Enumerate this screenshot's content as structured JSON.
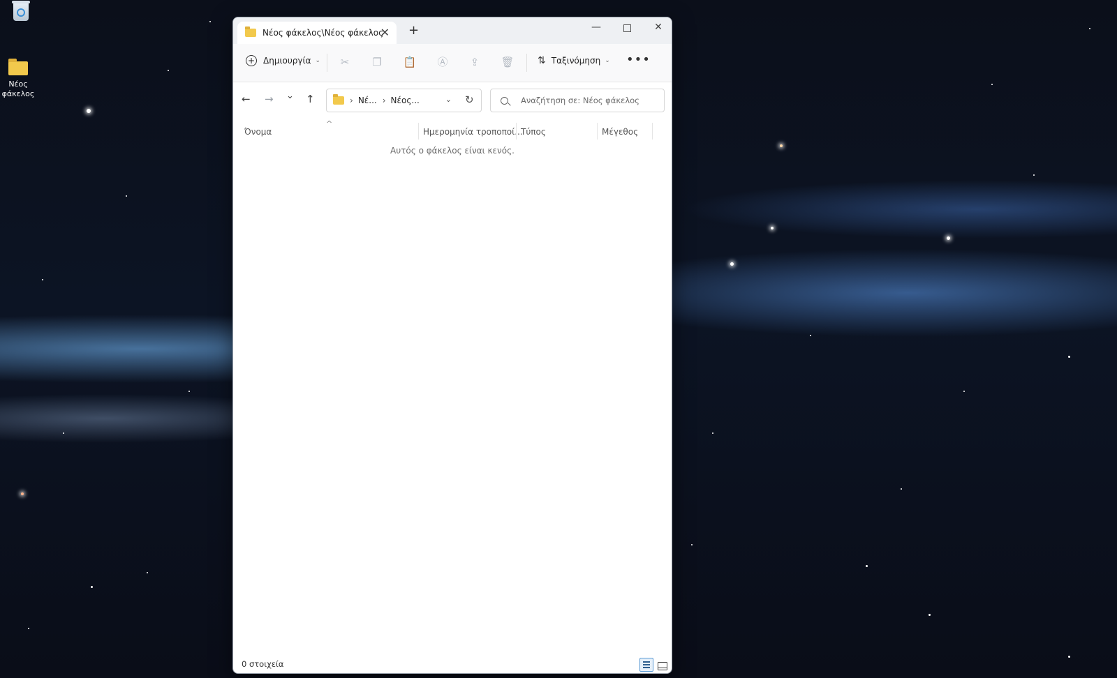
{
  "desktop": {
    "recycle_bin": {
      "icon": "recycle-bin-icon"
    },
    "folder": {
      "label": "Νέος φάκελος",
      "icon": "folder-icon"
    }
  },
  "window": {
    "tab": {
      "title": "Νέος φάκελος\\Νέος φάκελος",
      "icon": "folder-icon",
      "close": "✕"
    },
    "new_tab": "+",
    "controls": {
      "minimize": "—",
      "maximize": "",
      "close": "✕"
    },
    "toolbar": {
      "new_label": "Δημιουργία",
      "sort_label": "Ταξινόμηση",
      "more": "•••",
      "icons": [
        "cut-icon",
        "copy-icon",
        "paste-icon",
        "rename-icon",
        "share-icon",
        "delete-icon"
      ]
    },
    "nav": {
      "back": "←",
      "forward": "→",
      "recent": "⌄",
      "up": "↑",
      "breadcrumb": [
        "Νέ...",
        "Νέος..."
      ],
      "crumb_sep": "›",
      "refresh": "↻"
    },
    "search": {
      "placeholder": "Αναζήτηση σε: Νέος φάκελος"
    },
    "columns": {
      "name": "Όνομα",
      "date": "Ημερομηνία τροποποί...",
      "type": "Τύπος",
      "size": "Μέγεθος"
    },
    "empty_message": "Αυτός ο φάκελος είναι κενός.",
    "status": "0 στοιχεία"
  },
  "colors": {
    "accent": "#5b9bd5",
    "folder": "#f2c94c"
  }
}
